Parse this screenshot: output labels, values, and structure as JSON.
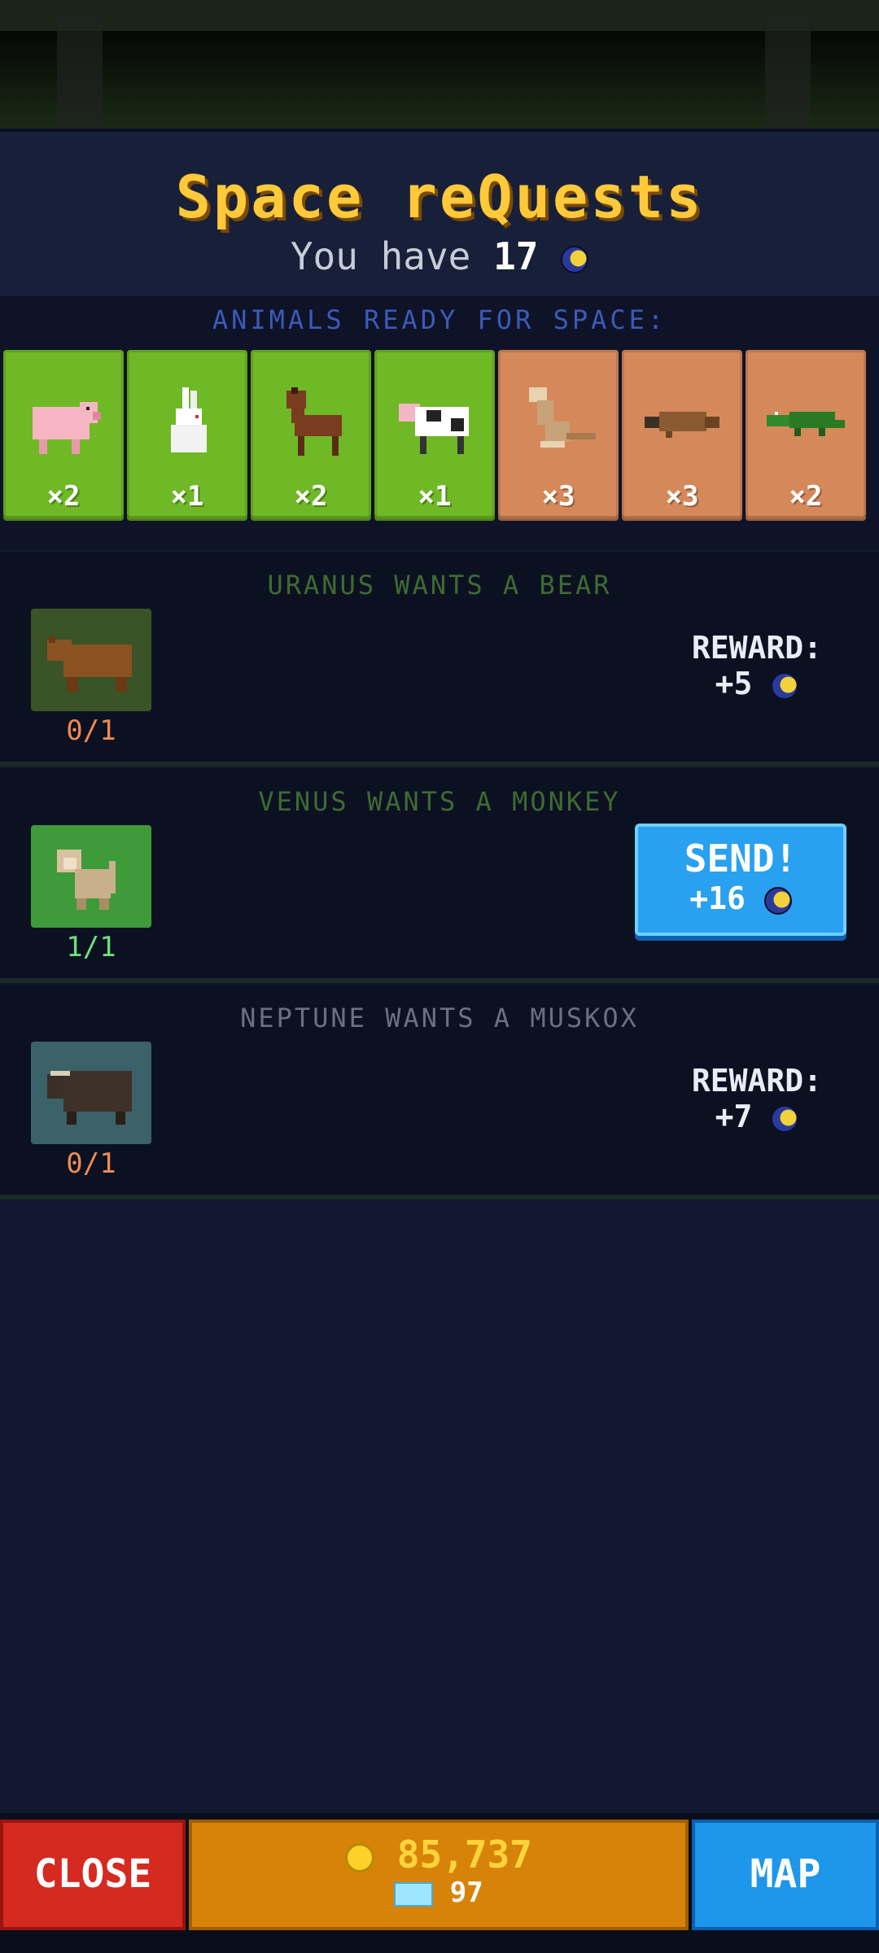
{
  "header": {
    "title": "Space reQuests",
    "have_prefix": "You have",
    "have_count": "17"
  },
  "ready": {
    "label": "ANIMALS READY FOR SPACE:",
    "animals": [
      {
        "name": "pig",
        "count": "×2",
        "card": "green"
      },
      {
        "name": "rabbit",
        "count": "×1",
        "card": "green"
      },
      {
        "name": "horse",
        "count": "×2",
        "card": "green"
      },
      {
        "name": "cow",
        "count": "×1",
        "card": "green"
      },
      {
        "name": "kangaroo",
        "count": "×3",
        "card": "tan"
      },
      {
        "name": "platypus",
        "count": "×3",
        "card": "tan"
      },
      {
        "name": "crocodile",
        "count": "×2",
        "card": "tan"
      }
    ]
  },
  "requests": [
    {
      "title": "URANUS WANTS A BEAR",
      "progress": "0/1",
      "reward_label": "REWARD:",
      "reward_value": "+5"
    },
    {
      "title": "VENUS WANTS A MONKEY",
      "progress": "1/1",
      "send_label": "SEND!",
      "reward_value": "+16"
    },
    {
      "title": "NEPTUNE WANTS A MUSKOX",
      "progress": "0/1",
      "reward_label": "REWARD:",
      "reward_value": "+7"
    }
  ],
  "bottom": {
    "close_label": "CLOSE",
    "coins": "85,737",
    "gems": "97",
    "map_label": "MAP"
  },
  "colors": {
    "title": "#ffc93a",
    "green_card": "#6fb826",
    "tan_card": "#d5895a",
    "send_button": "#2aa0f0",
    "close_button": "#d42a20",
    "map_button": "#1e96ea"
  }
}
